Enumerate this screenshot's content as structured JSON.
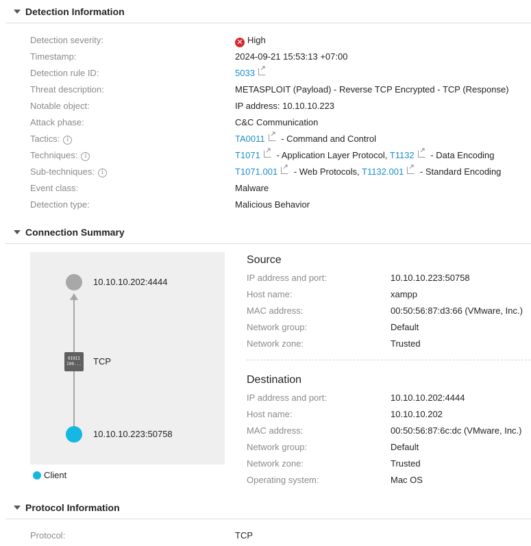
{
  "detection": {
    "title": "Detection Information",
    "rows": {
      "severity": {
        "label": "Detection severity:",
        "value": "High"
      },
      "timestamp": {
        "label": "Timestamp:",
        "value": "2024-09-21 15:53:13 +07:00"
      },
      "rule_id": {
        "label": "Detection rule ID:",
        "value": "5033"
      },
      "threat": {
        "label": "Threat description:",
        "value": "METASPLOIT (Payload) - Reverse TCP Encrypted - TCP (Response)"
      },
      "notable": {
        "label": "Notable object:",
        "value": "IP address: 10.10.10.223"
      },
      "phase": {
        "label": "Attack phase:",
        "value": "C&C Communication"
      },
      "tactics": {
        "label": "Tactics:",
        "link1": "TA0011",
        "text1": "- Command and Control"
      },
      "techniques": {
        "label": "Techniques:",
        "link1": "T1071",
        "text1": "- Application Layer Protocol,",
        "link2": "T1132",
        "text2": "- Data Encoding"
      },
      "subtech": {
        "label": "Sub-techniques:",
        "link1": "T1071.001",
        "text1": "- Web Protocols,",
        "link2": "T1132.001",
        "text2": "- Standard Encoding"
      },
      "event_class": {
        "label": "Event class:",
        "value": "Malware"
      },
      "det_type": {
        "label": "Detection type:",
        "value": "Malicious Behavior"
      }
    },
    "colors": {
      "severity_high": "#d9262c",
      "link": "#1a8fc9"
    }
  },
  "connection": {
    "title": "Connection Summary",
    "diagram": {
      "server_label": "10.10.10.202:4444",
      "protocol_label": "TCP",
      "protocol_icon_text": "0I0II\nI00...",
      "client_label": "10.10.10.223:50758",
      "legend_label": "Client",
      "client_color": "#15b8e2"
    },
    "source": {
      "title": "Source",
      "rows": [
        {
          "label": "IP address and port:",
          "value": "10.10.10.223:50758"
        },
        {
          "label": "Host name:",
          "value": "xampp"
        },
        {
          "label": "MAC address:",
          "value": "00:50:56:87:d3:66 (VMware, Inc.)"
        },
        {
          "label": "Network group:",
          "value": "Default"
        },
        {
          "label": "Network zone:",
          "value": "Trusted"
        }
      ]
    },
    "destination": {
      "title": "Destination",
      "rows": [
        {
          "label": "IP address and port:",
          "value": "10.10.10.202:4444"
        },
        {
          "label": "Host name:",
          "value": "10.10.10.202"
        },
        {
          "label": "MAC address:",
          "value": "00:50:56:87:6c:dc (VMware, Inc.)"
        },
        {
          "label": "Network group:",
          "value": "Default"
        },
        {
          "label": "Network zone:",
          "value": "Trusted"
        },
        {
          "label": "Operating system:",
          "value": "Mac OS"
        }
      ]
    }
  },
  "protocol": {
    "title": "Protocol Information",
    "rows": {
      "protocol": {
        "label": "Protocol:",
        "value": "TCP"
      }
    }
  }
}
